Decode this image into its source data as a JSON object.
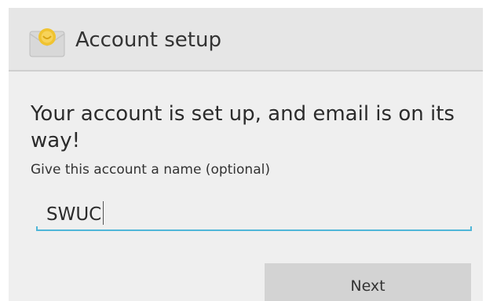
{
  "action_bar": {
    "title": "Account setup",
    "icon": "email-envelope-icon"
  },
  "content": {
    "headline": "Your account is set up, and email is on its way!",
    "name_label": "Give this account a name (optional)",
    "name_value": "SWUC"
  },
  "footer": {
    "next_label": "Next"
  },
  "colors": {
    "accent": "#4fb6d8",
    "background": "#efefef",
    "action_bar": "#e6e6e6",
    "button": "#d3d3d3"
  }
}
